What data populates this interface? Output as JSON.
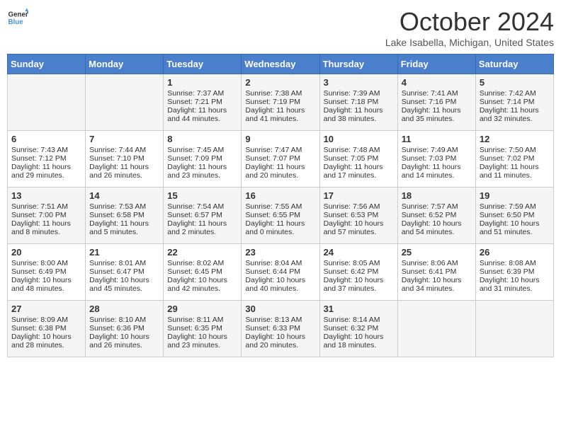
{
  "header": {
    "logo_line1": "General",
    "logo_line2": "Blue",
    "title": "October 2024",
    "location": "Lake Isabella, Michigan, United States"
  },
  "days_of_week": [
    "Sunday",
    "Monday",
    "Tuesday",
    "Wednesday",
    "Thursday",
    "Friday",
    "Saturday"
  ],
  "weeks": [
    [
      {
        "day": "",
        "sunrise": "",
        "sunset": "",
        "daylight": ""
      },
      {
        "day": "",
        "sunrise": "",
        "sunset": "",
        "daylight": ""
      },
      {
        "day": "1",
        "sunrise": "Sunrise: 7:37 AM",
        "sunset": "Sunset: 7:21 PM",
        "daylight": "Daylight: 11 hours and 44 minutes."
      },
      {
        "day": "2",
        "sunrise": "Sunrise: 7:38 AM",
        "sunset": "Sunset: 7:19 PM",
        "daylight": "Daylight: 11 hours and 41 minutes."
      },
      {
        "day": "3",
        "sunrise": "Sunrise: 7:39 AM",
        "sunset": "Sunset: 7:18 PM",
        "daylight": "Daylight: 11 hours and 38 minutes."
      },
      {
        "day": "4",
        "sunrise": "Sunrise: 7:41 AM",
        "sunset": "Sunset: 7:16 PM",
        "daylight": "Daylight: 11 hours and 35 minutes."
      },
      {
        "day": "5",
        "sunrise": "Sunrise: 7:42 AM",
        "sunset": "Sunset: 7:14 PM",
        "daylight": "Daylight: 11 hours and 32 minutes."
      }
    ],
    [
      {
        "day": "6",
        "sunrise": "Sunrise: 7:43 AM",
        "sunset": "Sunset: 7:12 PM",
        "daylight": "Daylight: 11 hours and 29 minutes."
      },
      {
        "day": "7",
        "sunrise": "Sunrise: 7:44 AM",
        "sunset": "Sunset: 7:10 PM",
        "daylight": "Daylight: 11 hours and 26 minutes."
      },
      {
        "day": "8",
        "sunrise": "Sunrise: 7:45 AM",
        "sunset": "Sunset: 7:09 PM",
        "daylight": "Daylight: 11 hours and 23 minutes."
      },
      {
        "day": "9",
        "sunrise": "Sunrise: 7:47 AM",
        "sunset": "Sunset: 7:07 PM",
        "daylight": "Daylight: 11 hours and 20 minutes."
      },
      {
        "day": "10",
        "sunrise": "Sunrise: 7:48 AM",
        "sunset": "Sunset: 7:05 PM",
        "daylight": "Daylight: 11 hours and 17 minutes."
      },
      {
        "day": "11",
        "sunrise": "Sunrise: 7:49 AM",
        "sunset": "Sunset: 7:03 PM",
        "daylight": "Daylight: 11 hours and 14 minutes."
      },
      {
        "day": "12",
        "sunrise": "Sunrise: 7:50 AM",
        "sunset": "Sunset: 7:02 PM",
        "daylight": "Daylight: 11 hours and 11 minutes."
      }
    ],
    [
      {
        "day": "13",
        "sunrise": "Sunrise: 7:51 AM",
        "sunset": "Sunset: 7:00 PM",
        "daylight": "Daylight: 11 hours and 8 minutes."
      },
      {
        "day": "14",
        "sunrise": "Sunrise: 7:53 AM",
        "sunset": "Sunset: 6:58 PM",
        "daylight": "Daylight: 11 hours and 5 minutes."
      },
      {
        "day": "15",
        "sunrise": "Sunrise: 7:54 AM",
        "sunset": "Sunset: 6:57 PM",
        "daylight": "Daylight: 11 hours and 2 minutes."
      },
      {
        "day": "16",
        "sunrise": "Sunrise: 7:55 AM",
        "sunset": "Sunset: 6:55 PM",
        "daylight": "Daylight: 11 hours and 0 minutes."
      },
      {
        "day": "17",
        "sunrise": "Sunrise: 7:56 AM",
        "sunset": "Sunset: 6:53 PM",
        "daylight": "Daylight: 10 hours and 57 minutes."
      },
      {
        "day": "18",
        "sunrise": "Sunrise: 7:57 AM",
        "sunset": "Sunset: 6:52 PM",
        "daylight": "Daylight: 10 hours and 54 minutes."
      },
      {
        "day": "19",
        "sunrise": "Sunrise: 7:59 AM",
        "sunset": "Sunset: 6:50 PM",
        "daylight": "Daylight: 10 hours and 51 minutes."
      }
    ],
    [
      {
        "day": "20",
        "sunrise": "Sunrise: 8:00 AM",
        "sunset": "Sunset: 6:49 PM",
        "daylight": "Daylight: 10 hours and 48 minutes."
      },
      {
        "day": "21",
        "sunrise": "Sunrise: 8:01 AM",
        "sunset": "Sunset: 6:47 PM",
        "daylight": "Daylight: 10 hours and 45 minutes."
      },
      {
        "day": "22",
        "sunrise": "Sunrise: 8:02 AM",
        "sunset": "Sunset: 6:45 PM",
        "daylight": "Daylight: 10 hours and 42 minutes."
      },
      {
        "day": "23",
        "sunrise": "Sunrise: 8:04 AM",
        "sunset": "Sunset: 6:44 PM",
        "daylight": "Daylight: 10 hours and 40 minutes."
      },
      {
        "day": "24",
        "sunrise": "Sunrise: 8:05 AM",
        "sunset": "Sunset: 6:42 PM",
        "daylight": "Daylight: 10 hours and 37 minutes."
      },
      {
        "day": "25",
        "sunrise": "Sunrise: 8:06 AM",
        "sunset": "Sunset: 6:41 PM",
        "daylight": "Daylight: 10 hours and 34 minutes."
      },
      {
        "day": "26",
        "sunrise": "Sunrise: 8:08 AM",
        "sunset": "Sunset: 6:39 PM",
        "daylight": "Daylight: 10 hours and 31 minutes."
      }
    ],
    [
      {
        "day": "27",
        "sunrise": "Sunrise: 8:09 AM",
        "sunset": "Sunset: 6:38 PM",
        "daylight": "Daylight: 10 hours and 28 minutes."
      },
      {
        "day": "28",
        "sunrise": "Sunrise: 8:10 AM",
        "sunset": "Sunset: 6:36 PM",
        "daylight": "Daylight: 10 hours and 26 minutes."
      },
      {
        "day": "29",
        "sunrise": "Sunrise: 8:11 AM",
        "sunset": "Sunset: 6:35 PM",
        "daylight": "Daylight: 10 hours and 23 minutes."
      },
      {
        "day": "30",
        "sunrise": "Sunrise: 8:13 AM",
        "sunset": "Sunset: 6:33 PM",
        "daylight": "Daylight: 10 hours and 20 minutes."
      },
      {
        "day": "31",
        "sunrise": "Sunrise: 8:14 AM",
        "sunset": "Sunset: 6:32 PM",
        "daylight": "Daylight: 10 hours and 18 minutes."
      },
      {
        "day": "",
        "sunrise": "",
        "sunset": "",
        "daylight": ""
      },
      {
        "day": "",
        "sunrise": "",
        "sunset": "",
        "daylight": ""
      }
    ]
  ]
}
